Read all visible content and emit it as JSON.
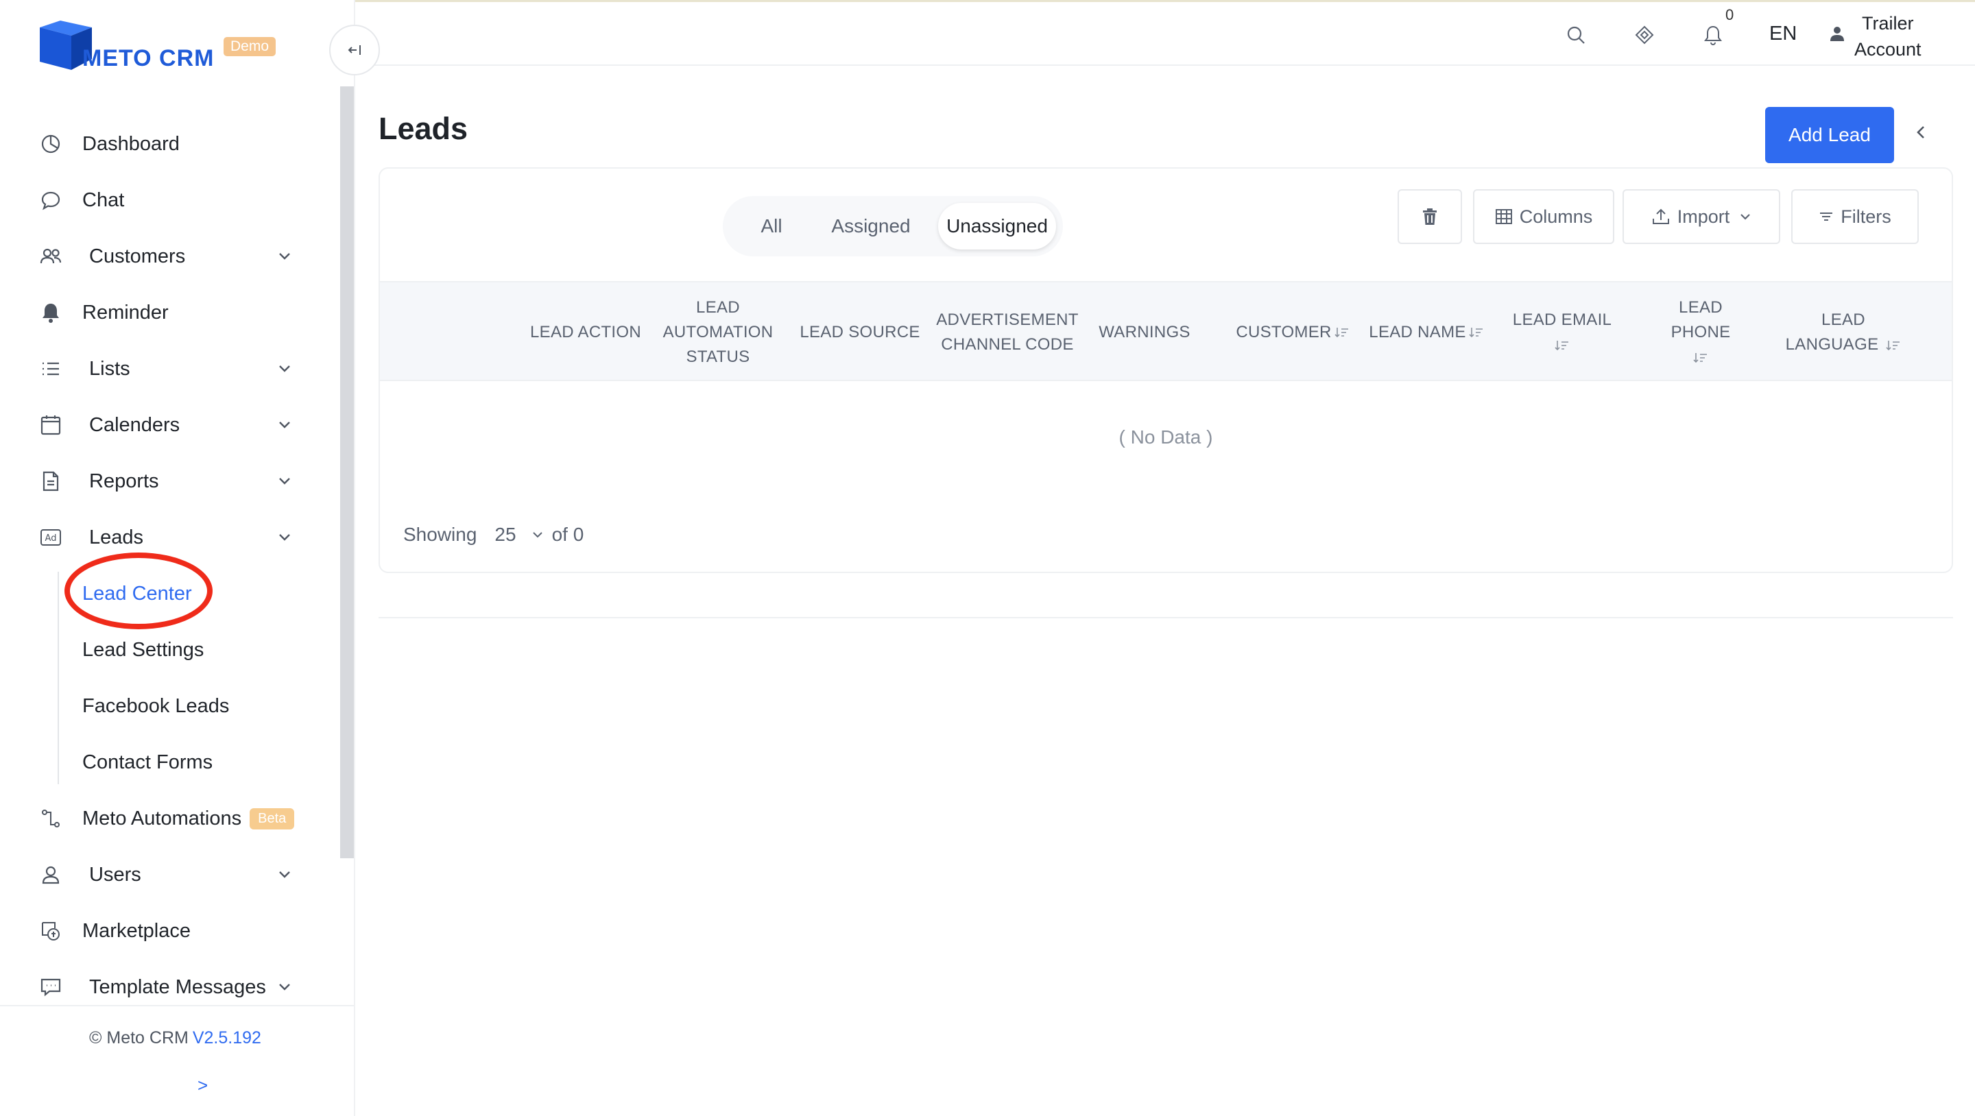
{
  "brand": {
    "name": "METO CRM",
    "badge": "Demo"
  },
  "sidebar": {
    "items": [
      {
        "label": "Dashboard",
        "icon": "dashboard-icon",
        "chevron": false
      },
      {
        "label": "Chat",
        "icon": "chat-icon",
        "chevron": false
      },
      {
        "label": "Customers",
        "icon": "customers-icon",
        "chevron": true
      },
      {
        "label": "Reminder",
        "icon": "bell-icon",
        "chevron": false
      },
      {
        "label": "Lists",
        "icon": "list-icon",
        "chevron": true
      },
      {
        "label": "Calenders",
        "icon": "calendar-icon",
        "chevron": true
      },
      {
        "label": "Reports",
        "icon": "report-icon",
        "chevron": true
      },
      {
        "label": "Leads",
        "icon": "ad-icon",
        "chevron": true
      },
      {
        "label": "Meto Automations",
        "icon": "automation-icon",
        "chevron": false,
        "badge": "Beta"
      },
      {
        "label": "Users",
        "icon": "user-icon",
        "chevron": true
      },
      {
        "label": "Marketplace",
        "icon": "marketplace-icon",
        "chevron": false
      },
      {
        "label": "Template Messages",
        "icon": "template-icon",
        "chevron": true
      }
    ],
    "leads_sub": [
      {
        "label": "Lead Center",
        "active": true
      },
      {
        "label": "Lead Settings",
        "active": false
      },
      {
        "label": "Facebook Leads",
        "active": false
      },
      {
        "label": "Contact Forms",
        "active": false
      }
    ],
    "footer": {
      "copyright": "© Meto CRM",
      "version": "V2.5.192",
      "expand_label": ">"
    }
  },
  "topbar": {
    "notification_count": "0",
    "language": "EN",
    "account_line1": "Trailer",
    "account_line2": "Account"
  },
  "main": {
    "title": "Leads",
    "add_button": "Add Lead",
    "tabs": [
      {
        "label": "All",
        "selected": false
      },
      {
        "label": "Assigned",
        "selected": false
      },
      {
        "label": "Unassigned",
        "selected": true
      }
    ],
    "toolbar": {
      "columns_label": "Columns",
      "import_label": "Import",
      "filters_label": "Filters"
    },
    "columns": [
      {
        "label": "LEAD ACTION",
        "sortable": false
      },
      {
        "label": "LEAD AUTOMATION STATUS",
        "sortable": false
      },
      {
        "label": "LEAD SOURCE",
        "sortable": false
      },
      {
        "label": "ADVERTISEMENT CHANNEL CODE",
        "sortable": false
      },
      {
        "label": "WARNINGS",
        "sortable": false
      },
      {
        "label": "CUSTOMER",
        "sortable": true
      },
      {
        "label": "LEAD NAME",
        "sortable": true
      },
      {
        "label": "LEAD EMAIL",
        "sortable": true
      },
      {
        "label": "LEAD PHONE",
        "sortable": true
      },
      {
        "label": "LEAD LANGUAGE",
        "sortable": true
      }
    ],
    "empty_text": "( No Data )",
    "pagination": {
      "showing_label": "Showing",
      "page_size": "25",
      "of_label": "of 0"
    }
  },
  "colors": {
    "accent": "#2f6bf0",
    "highlight": "#ef2b1a",
    "badge": "#f5c48c"
  }
}
